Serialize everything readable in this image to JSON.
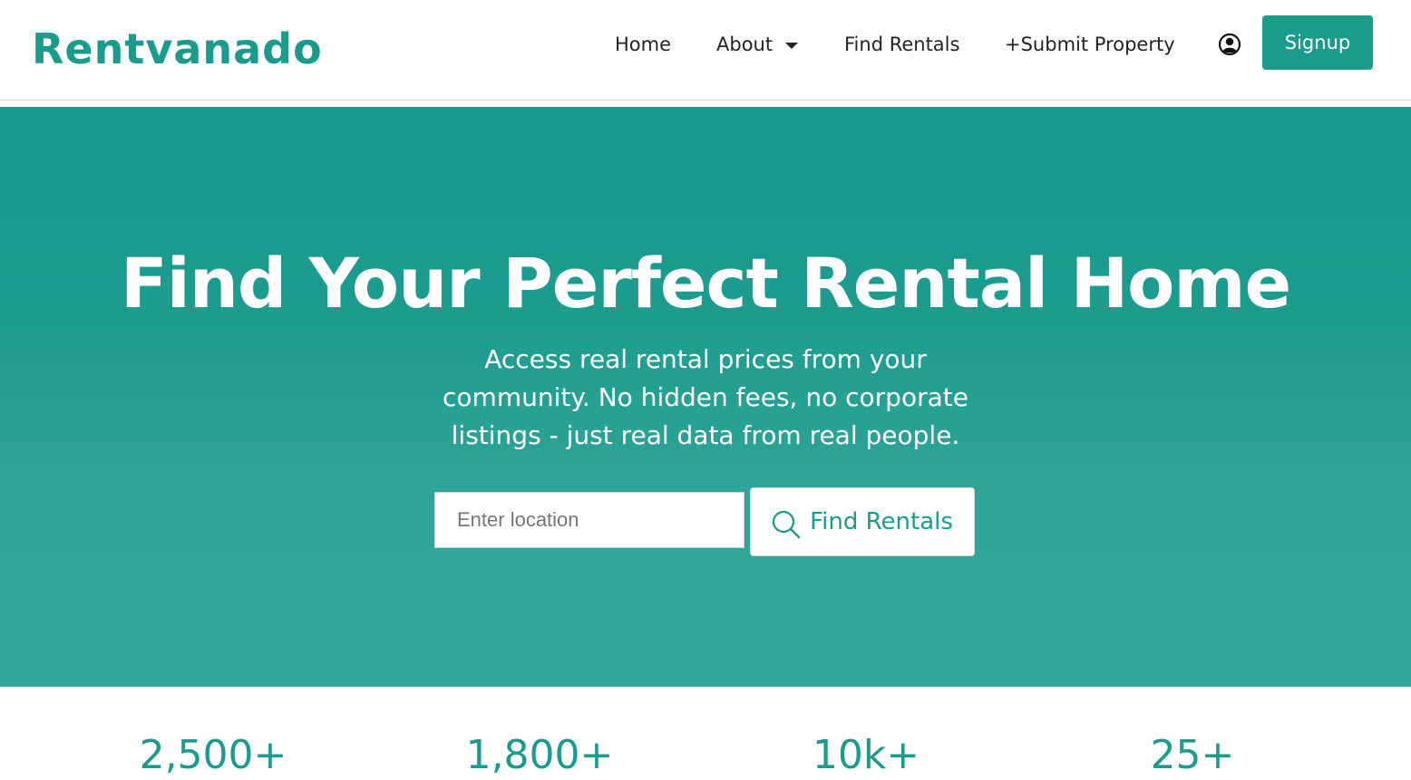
{
  "header": {
    "logo_text": "Rentvanado",
    "nav": {
      "home": "Home",
      "about": "About",
      "find_rentals": "Find Rentals",
      "submit_property": "+Submit Property"
    },
    "user_icon": "user-circle-icon",
    "signup_label": "Signup"
  },
  "hero": {
    "title": "Find Your Perfect Rental Home",
    "subtitle_lines": [
      "Access real rental prices from your",
      "community. No hidden fees, no corporate",
      "listings - just real data from real people."
    ],
    "search": {
      "placeholder": "Enter location",
      "value": ""
    },
    "find_button_label": "Find Rentals",
    "find_button_icon": "search-icon"
  },
  "stats": [
    {
      "value": "2,500+"
    },
    {
      "value": "1,800+"
    },
    {
      "value": "10k+"
    },
    {
      "value": "25+"
    }
  ],
  "colors": {
    "brand": "#1a9b8c",
    "hero_top": "#17998b",
    "hero_bottom": "#33a79a",
    "text_dark": "#222222",
    "white": "#ffffff"
  }
}
